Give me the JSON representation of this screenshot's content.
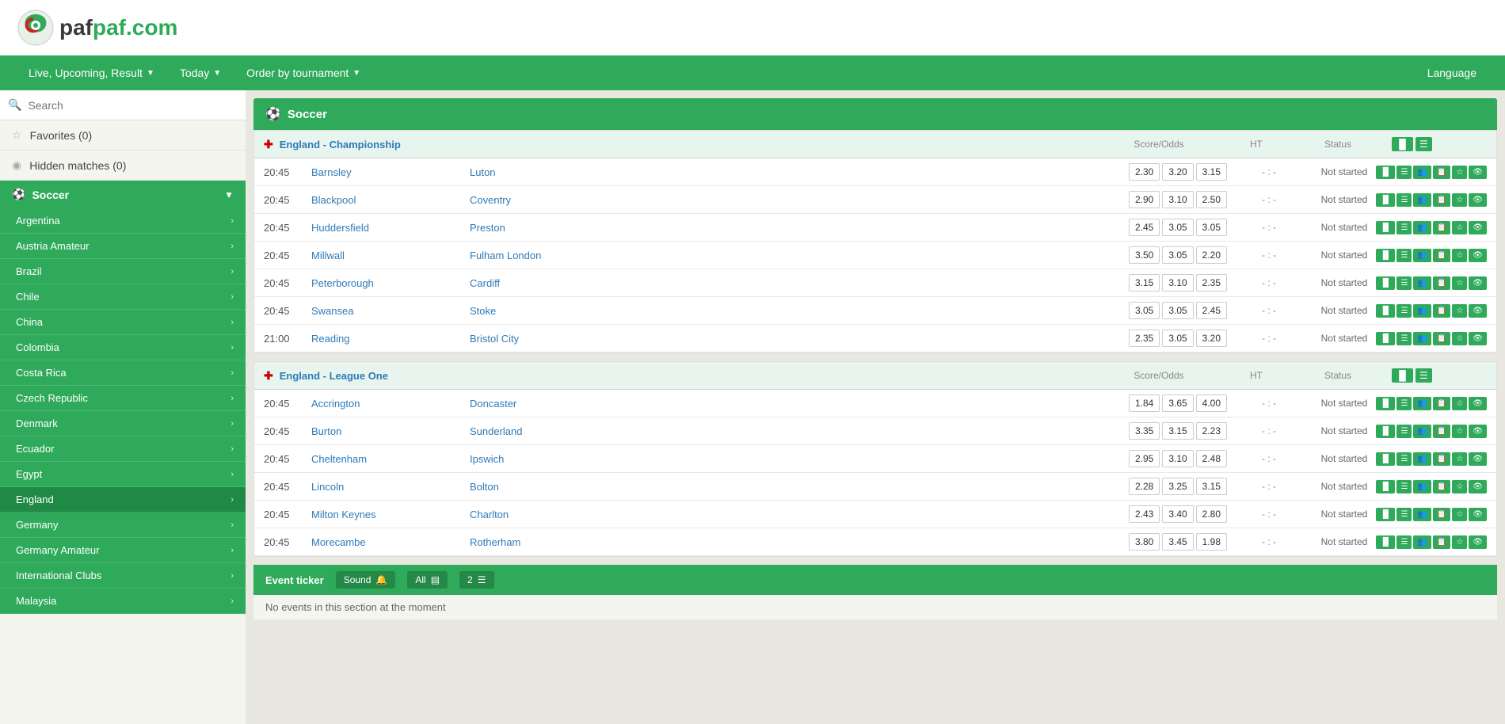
{
  "header": {
    "logo_text": "paf.com"
  },
  "nav": {
    "items": [
      {
        "label": "Live, Upcoming, Result",
        "has_arrow": true
      },
      {
        "label": "Today",
        "has_arrow": true
      },
      {
        "label": "Order by tournament",
        "has_arrow": true
      }
    ],
    "language_label": "Language"
  },
  "sidebar": {
    "search_placeholder": "Search",
    "favorites_label": "Favorites (0)",
    "hidden_matches_label": "Hidden matches (0)",
    "soccer_label": "Soccer",
    "countries": [
      "Argentina",
      "Austria Amateur",
      "Brazil",
      "Chile",
      "China",
      "Colombia",
      "Costa Rica",
      "Czech Republic",
      "Denmark",
      "Ecuador",
      "Egypt",
      "England",
      "Germany",
      "Germany Amateur",
      "International Clubs",
      "Malaysia"
    ]
  },
  "main_section": {
    "title": "Soccer"
  },
  "tournaments": [
    {
      "flag": "✚",
      "name": "England - Championship",
      "col_score": "Score/Odds",
      "col_ht": "HT",
      "col_status": "Status",
      "matches": [
        {
          "time": "20:45",
          "home": "Barnsley",
          "away": "Luton",
          "odds": [
            "2.30",
            "3.20",
            "3.15"
          ],
          "ht": "- : -",
          "status": "Not started"
        },
        {
          "time": "20:45",
          "home": "Blackpool",
          "away": "Coventry",
          "odds": [
            "2.90",
            "3.10",
            "2.50"
          ],
          "ht": "- : -",
          "status": "Not started"
        },
        {
          "time": "20:45",
          "home": "Huddersfield",
          "away": "Preston",
          "odds": [
            "2.45",
            "3.05",
            "3.05"
          ],
          "ht": "- : -",
          "status": "Not started"
        },
        {
          "time": "20:45",
          "home": "Millwall",
          "away": "Fulham London",
          "odds": [
            "3.50",
            "3.05",
            "2.20"
          ],
          "ht": "- : -",
          "status": "Not started"
        },
        {
          "time": "20:45",
          "home": "Peterborough",
          "away": "Cardiff",
          "odds": [
            "3.15",
            "3.10",
            "2.35"
          ],
          "ht": "- : -",
          "status": "Not started"
        },
        {
          "time": "20:45",
          "home": "Swansea",
          "away": "Stoke",
          "odds": [
            "3.05",
            "3.05",
            "2.45"
          ],
          "ht": "- : -",
          "status": "Not started"
        },
        {
          "time": "21:00",
          "home": "Reading",
          "away": "Bristol City",
          "odds": [
            "2.35",
            "3.05",
            "3.20"
          ],
          "ht": "- : -",
          "status": "Not started"
        }
      ]
    },
    {
      "flag": "✚",
      "name": "England - League One",
      "col_score": "Score/Odds",
      "col_ht": "HT",
      "col_status": "Status",
      "matches": [
        {
          "time": "20:45",
          "home": "Accrington",
          "away": "Doncaster",
          "odds": [
            "1.84",
            "3.65",
            "4.00"
          ],
          "ht": "- : -",
          "status": "Not started"
        },
        {
          "time": "20:45",
          "home": "Burton",
          "away": "Sunderland",
          "odds": [
            "3.35",
            "3.15",
            "2.23"
          ],
          "ht": "- : -",
          "status": "Not started"
        },
        {
          "time": "20:45",
          "home": "Cheltenham",
          "away": "Ipswich",
          "odds": [
            "2.95",
            "3.10",
            "2.48"
          ],
          "ht": "- : -",
          "status": "Not started"
        },
        {
          "time": "20:45",
          "home": "Lincoln",
          "away": "Bolton",
          "odds": [
            "2.28",
            "3.25",
            "3.15"
          ],
          "ht": "- : -",
          "status": "Not started"
        },
        {
          "time": "20:45",
          "home": "Milton Keynes",
          "away": "Charlton",
          "odds": [
            "2.43",
            "3.40",
            "2.80"
          ],
          "ht": "- : -",
          "status": "Not started"
        },
        {
          "time": "20:45",
          "home": "Morecambe",
          "away": "Rotherham",
          "odds": [
            "3.80",
            "3.45",
            "1.98"
          ],
          "ht": "- : -",
          "status": "Not started"
        }
      ]
    }
  ],
  "event_ticker": {
    "label": "Event ticker",
    "sound_label": "Sound",
    "all_label": "All",
    "num_label": "2",
    "empty_msg": "No events in this section at the moment"
  }
}
